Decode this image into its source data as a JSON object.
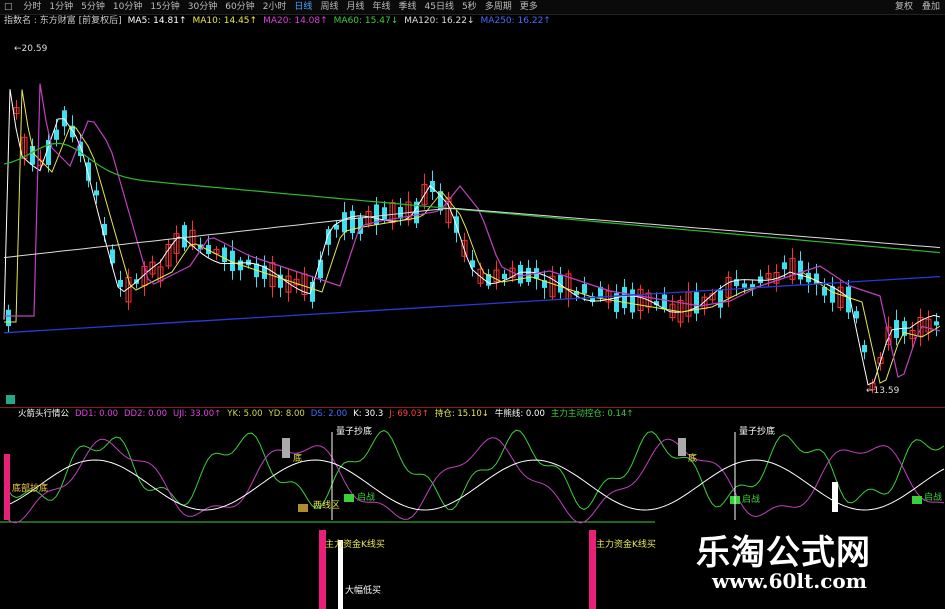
{
  "toolbar": {
    "left_icon": "□",
    "periods": [
      "分时",
      "1分钟",
      "5分钟",
      "10分钟",
      "15分钟",
      "30分钟",
      "60分钟",
      "2小时",
      "日线",
      "周线",
      "月线",
      "年线",
      "季线",
      "45日线",
      "5秒",
      "多周期",
      "更多"
    ],
    "active_period": "日线",
    "right_items": [
      "复权",
      "叠加"
    ]
  },
  "ma_bar": {
    "items": [
      {
        "text": "指数名 : 东方财富 [前复权后]",
        "color": "#cccccc"
      },
      {
        "text": "MA5: 14.81↑",
        "color": "#ffffff"
      },
      {
        "text": "MA10: 14.45↑",
        "color": "#e8e84a"
      },
      {
        "text": "MA20: 14.08↑",
        "color": "#e040e0"
      },
      {
        "text": "MA60: 15.47↓",
        "color": "#3ad03a"
      },
      {
        "text": "MA120: 16.22↓",
        "color": "#dddddd"
      },
      {
        "text": "MA250: 16.22↑",
        "color": "#4a6aff"
      }
    ]
  },
  "price_labels": {
    "high": "20.59",
    "low": "13.59"
  },
  "indicator_bar": {
    "items": [
      {
        "text": "火箭头行情公",
        "color": "#ffffff"
      },
      {
        "text": "DD1: 0.00",
        "color": "#e040e0"
      },
      {
        "text": "DD2: 0.00",
        "color": "#e040e0"
      },
      {
        "text": "UJI: 33.00↑",
        "color": "#e040e0"
      },
      {
        "text": "YK: 5.00",
        "color": "#d8d840"
      },
      {
        "text": "YD: 8.00",
        "color": "#d8d840"
      },
      {
        "text": "DS: 2.00",
        "color": "#4a6aff"
      },
      {
        "text": "K: 30.3",
        "color": "#ffffff"
      },
      {
        "text": "J: 69.03↑",
        "color": "#ff4040"
      },
      {
        "text": "持仓: 15.10↓",
        "color": "#e8e84a"
      },
      {
        "text": "牛熊线: 0.00",
        "color": "#ffffff"
      },
      {
        "text": "主力主动控仓: 0.14↑",
        "color": "#3ad03a"
      }
    ]
  },
  "chart_labels": {
    "signal_left": "底部抄底",
    "di_1": "底",
    "di_2": "底",
    "quantum_1": "量子抄底",
    "quantum_2": "量子抄底",
    "low_zone": "两线区",
    "green_1": "启战",
    "green_2": "启战",
    "green_3": "启战",
    "main_1": "主力资金K线买",
    "main_2": "主力资金K线买",
    "volume_label": "大幅低买"
  },
  "colors": {
    "up": "#ff3030",
    "down": "#3ee0f0",
    "ma5": "#ffffff",
    "ma10": "#e8e84a",
    "ma20": "#c040c0",
    "ma60": "#2fb82f",
    "ma120": "#dddddd",
    "ma250": "#2a3ad8",
    "accent": "#4aa3ff"
  },
  "watermark": {
    "title": "乐淘公式网",
    "url": "www.60lt.com"
  }
}
